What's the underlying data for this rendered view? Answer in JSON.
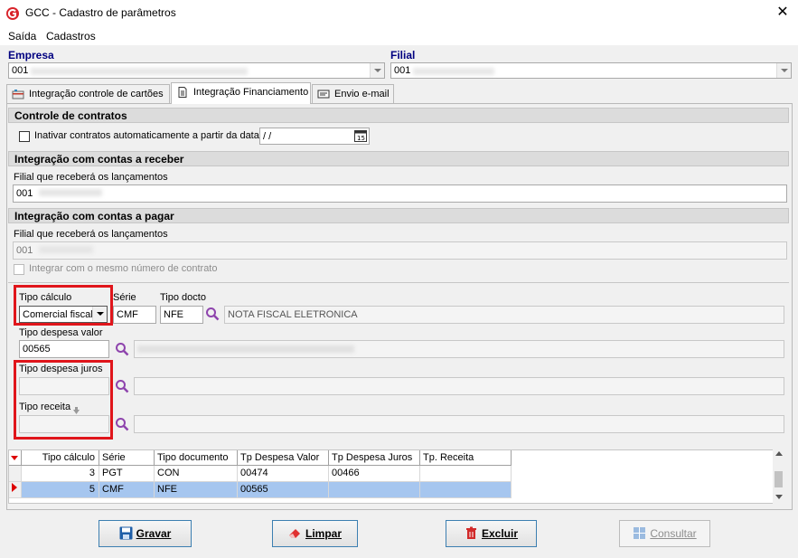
{
  "window": {
    "title": "GCC - Cadastro de parâmetros"
  },
  "menu": [
    {
      "label": "Saída"
    },
    {
      "label": "Cadastros"
    }
  ],
  "empresa": {
    "label": "Empresa",
    "value": "001"
  },
  "filial": {
    "label": "Filial",
    "value": "001"
  },
  "tabs": [
    {
      "label": "Integração controle de cartões"
    },
    {
      "label": "Integração Financiamento"
    },
    {
      "label": "Envio e-mail"
    }
  ],
  "controle": {
    "header": "Controle de contratos",
    "checkbox_label": "Inativar contratos automaticamente a partir da data:",
    "date_value": " /  /"
  },
  "receber": {
    "header": "Integração com contas a receber",
    "filial_label": "Filial que receberá os lançamentos",
    "filial_value": "001"
  },
  "pagar": {
    "header": "Integração com contas a pagar",
    "filial_label": "Filial que receberá os lançamentos",
    "filial_value": "001",
    "checkbox_label": "Integrar com o mesmo número de contrato"
  },
  "form": {
    "tipo_calculo_label": "Tipo cálculo",
    "tipo_calculo_value": "Comercial fiscal",
    "serie_label": "Série",
    "serie_value": "CMF",
    "tipo_docto_label": "Tipo docto",
    "tipo_docto_value": "NFE",
    "tipo_docto_desc": "NOTA FISCAL ELETRONICA",
    "despesa_valor_label": "Tipo despesa valor",
    "despesa_valor_value": "00565",
    "despesa_juros_label": "Tipo despesa juros",
    "receita_label": "Tipo receita"
  },
  "grid": {
    "columns": [
      "Tipo cálculo",
      "Série",
      "Tipo documento",
      "Tp Despesa Valor",
      "Tp Despesa Juros",
      "Tp. Receita"
    ],
    "rows": [
      [
        "3",
        "PGT",
        "CON",
        "00474",
        "00466",
        ""
      ],
      [
        "5",
        "CMF",
        "NFE",
        "00565",
        "",
        ""
      ]
    ],
    "selected_row": 1
  },
  "buttons": {
    "gravar": "Gravar",
    "limpar": "Limpar",
    "excluir": "Excluir",
    "consultar": "Consultar"
  },
  "colors": {
    "accent_red": "#e0151b",
    "selection": "#a6c6ef",
    "label_blue": "#000080"
  }
}
